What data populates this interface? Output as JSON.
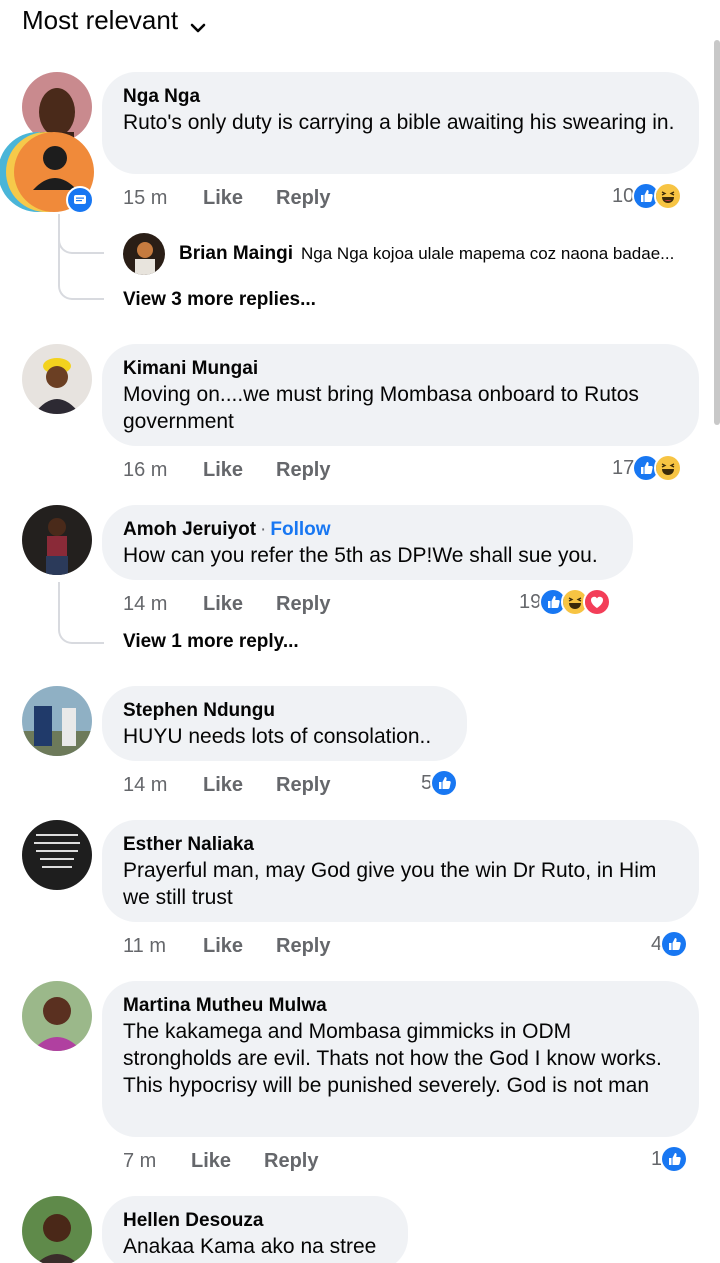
{
  "header": {
    "sort_label": "Most relevant"
  },
  "icons": {
    "chevron": "chevron-down-icon",
    "like": "like-icon",
    "haha": "haha-icon",
    "love": "love-icon",
    "messenger": "messenger-icon",
    "profile": "profile-icon"
  },
  "colors": {
    "like_blue": "#1877f2",
    "haha_yellow": "#f7c443",
    "love_red": "#f33e58",
    "bubble_bg": "#f0f2f5",
    "secondary_text": "#65676b"
  },
  "actions": {
    "like": "Like",
    "reply": "Reply"
  },
  "comments": [
    {
      "author": "Nga Nga",
      "text": "Ruto's only duty is carrying a bible awaiting his swearing in.",
      "time": "15 m",
      "reaction_count": "10",
      "reactions": [
        "like",
        "haha"
      ],
      "reply_preview": {
        "author": "Brian Maingi",
        "text": "Nga Nga kojoa ulale mapema coz naona badae..."
      },
      "view_more": "View 3 more replies..."
    },
    {
      "author": "Kimani Mungai",
      "text": "Moving on....we must bring Mombasa onboard to Rutos government",
      "time": "16 m",
      "reaction_count": "17",
      "reactions": [
        "like",
        "haha"
      ]
    },
    {
      "author": "Amoh Jeruiyot",
      "separator": "·",
      "follow": "Follow",
      "text": "How can you refer the 5th as DP!We shall sue you.",
      "time": "14 m",
      "reaction_count": "19",
      "reactions": [
        "like",
        "haha",
        "love"
      ],
      "view_more": "View 1 more reply..."
    },
    {
      "author": "Stephen Ndungu",
      "text": "HUYU needs lots of consolation..",
      "time": "14 m",
      "reaction_count": "5",
      "reactions": [
        "like"
      ]
    },
    {
      "author": "Esther Naliaka",
      "text": "Prayerful man, may God give you the win Dr Ruto, in Him we still trust",
      "time": "11 m",
      "reaction_count": "4",
      "reactions": [
        "like"
      ]
    },
    {
      "author": "Martina Mutheu Mulwa",
      "text": "The kakamega and Mombasa gimmicks in ODM strongholds are evil. Thats not how the God I know works. This hypocrisy will be punished severely. God is not man",
      "time": "7 m",
      "reaction_count": "1",
      "reactions": [
        "like"
      ]
    },
    {
      "author": "Hellen Desouza",
      "text": "Anakaa Kama ako na stree"
    }
  ]
}
